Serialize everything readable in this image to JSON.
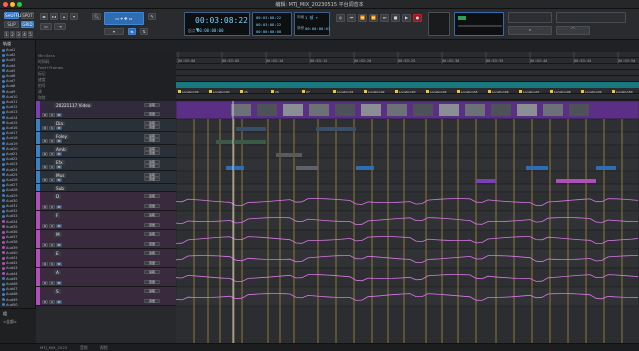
{
  "window": {
    "title": "编辑: MTJ_MIX_20230515 平台调音本"
  },
  "transport": {
    "main_counter": "00:03:08:22 ▾",
    "sub_counter_label": "起点",
    "sub_counter": "00:00:00:00",
    "start": "00:03:08:22",
    "end": "00:03:08:22",
    "length": "00:00:00:00",
    "nudge": "00:00:00:01",
    "grid": "1 帧 ▾",
    "nudge_label": "微移",
    "grid_label": "网格"
  },
  "toolbar": {
    "mode_labels": [
      "SHUFFLE",
      "SPOT",
      "SLIP",
      "GRID"
    ],
    "zoom_presets": [
      "1",
      "2",
      "3",
      "4",
      "5"
    ],
    "cursor_label": "▾"
  },
  "left_panel": {
    "header": "轨道",
    "tracks": [
      "Aud1",
      "Aud2",
      "Aud3",
      "Aud4",
      "Aud5",
      "Aud6",
      "Aud7",
      "Aud8",
      "Aud9",
      "Aud10",
      "Aud11",
      "Aud12",
      "Aud13",
      "Aud14",
      "Aud15",
      "Aud16",
      "Aud17",
      "Aud18",
      "Aud19",
      "Aud20",
      "Aud21",
      "Aud22",
      "Aud23",
      "Aud24",
      "Aud25",
      "Aud26",
      "Aud27",
      "Aud28",
      "Aud29",
      "Aud30",
      "Aud31",
      "Aud32",
      "Aud33",
      "Aud34",
      "Aud35",
      "Aud36",
      "Aud37",
      "Aud38",
      "Aud39",
      "Aud40",
      "Aud41",
      "Aud42",
      "Aud43",
      "Aud44",
      "Aud45",
      "Aud46",
      "Aud47",
      "Aud48",
      "Aud49",
      "Aud50"
    ],
    "groups_header": "组",
    "groups": [
      "<全部>"
    ]
  },
  "rulers": {
    "rows": [
      "Min:Secs",
      "时间码",
      "Feet+Frames",
      "标记",
      "速度",
      "拍号",
      "调",
      "和弦"
    ],
    "timecodes": [
      "00:03:00",
      "00:03:05",
      "00:03:10",
      "00:03:15",
      "00:03:20",
      "00:03:25",
      "00:03:30",
      "00:03:35",
      "00:03:40",
      "00:03:45",
      "00:03:50"
    ],
    "markers": [
      "Location39",
      "Location40",
      "25",
      "26",
      "27",
      "Location41",
      "Location42",
      "Location43",
      "Location44",
      "Location45",
      "Location46",
      "Location47",
      "Location48",
      "Location49",
      "Location50"
    ]
  },
  "tracks": [
    {
      "name": "20221117 Video",
      "type": "video",
      "color": "#7a3fb6",
      "height": 18
    },
    {
      "name": "Dia",
      "type": "audio",
      "color": "#3b7fc4",
      "height": 13
    },
    {
      "name": "Foley",
      "type": "audio",
      "color": "#3b7fc4",
      "height": 13
    },
    {
      "name": "Amb",
      "type": "audio",
      "color": "#3b7fc4",
      "height": 13
    },
    {
      "name": "Efx",
      "type": "audio",
      "color": "#3b7fc4",
      "height": 13
    },
    {
      "name": "Mus",
      "type": "audio",
      "color": "#3b7fc4",
      "height": 13
    },
    {
      "name": "Sub",
      "type": "audio",
      "color": "#3b7fc4",
      "height": 8
    },
    {
      "name": "D",
      "type": "aux",
      "color": "#b04fb9",
      "height": 19
    },
    {
      "name": "F",
      "type": "aux",
      "color": "#b04fb9",
      "height": 19
    },
    {
      "name": "M",
      "type": "aux",
      "color": "#b04fb9",
      "height": 19
    },
    {
      "name": "E",
      "type": "aux",
      "color": "#b04fb9",
      "height": 19
    },
    {
      "name": "A",
      "type": "aux",
      "color": "#b04fb9",
      "height": 19
    },
    {
      "name": "S",
      "type": "aux",
      "color": "#b04fb9",
      "height": 19
    }
  ],
  "track_header_labels": {
    "input": "输入 A 8",
    "output": "输入 A 2",
    "mode": "读取",
    "vol": "音量"
  },
  "bottom": {
    "tabs": [
      "MTJ_MIX_2023",
      "音频",
      "视频"
    ]
  },
  "colors": {
    "accent": "#2f6db3",
    "aux": "#b04fb9",
    "audio": "#3b7fc4",
    "video": "#7a3fb6",
    "marker": "#e6c84b"
  }
}
